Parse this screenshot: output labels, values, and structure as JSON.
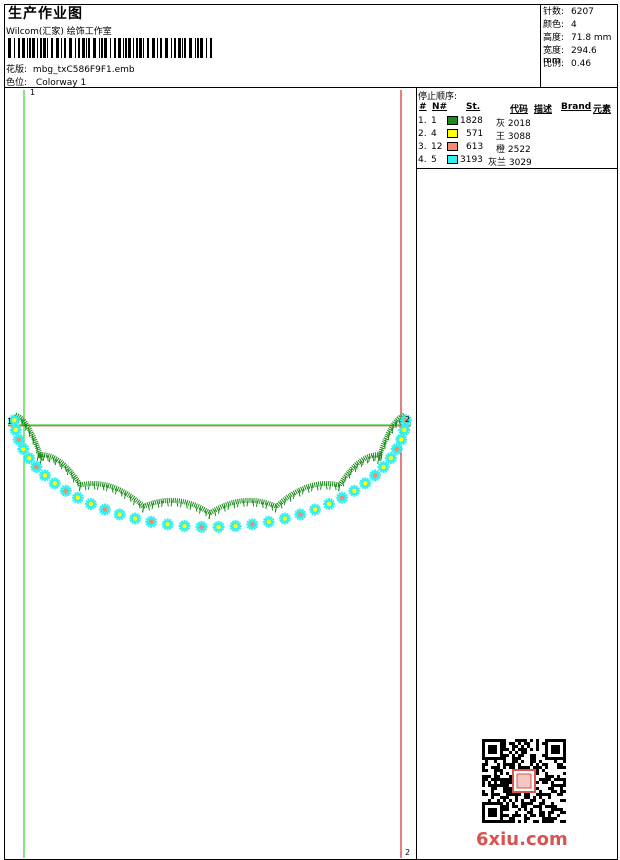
{
  "header": {
    "title": "生产作业图",
    "company": "Wilcom(汇家) 绘饰工作室",
    "design_label": "花版:",
    "design_value": "mbg_txC586F9F1.emb",
    "colorway_label": "色位:",
    "colorway_value": "Colorway 1"
  },
  "info": [
    {
      "label": "针数:",
      "value": "6207"
    },
    {
      "label": "颜色:",
      "value": "4"
    },
    {
      "label": "高度:",
      "value": "71.8 mm"
    },
    {
      "label": "宽度:",
      "value": "294.6 mm"
    },
    {
      "label": "比例:",
      "value": "0.46"
    }
  ],
  "stop_sequence": {
    "title": "停止顺序:",
    "headers": [
      "#",
      "N#",
      "St.",
      "代码",
      "描述",
      "Brand",
      "元素"
    ],
    "rows": [
      {
        "num": "1.",
        "n": "1",
        "color": "#1a8c1a",
        "st": "1828",
        "code": "灰 2018"
      },
      {
        "num": "2.",
        "n": "4",
        "color": "#ffff00",
        "st": "571",
        "code": "王 3088"
      },
      {
        "num": "3.",
        "n": "12",
        "color": "#f58a6e",
        "st": "613",
        "code": "橙 2522"
      },
      {
        "num": "4.",
        "n": "5",
        "color": "#33eeee",
        "st": "3193",
        "code": "灰兰 3029"
      }
    ]
  },
  "axis_labels": {
    "top_left": "1",
    "mid_left": "1",
    "mid_right": "2",
    "bottom_right": "2"
  },
  "watermark": "6xiu.com",
  "colors": {
    "guide_green": "#00cc00",
    "guide_red": "#cc0000",
    "scallop_green": "#1a8c1a",
    "flower_cyan": "#33eeee",
    "flower_yellow": "#ffff00",
    "flower_orange": "#f58a6e"
  }
}
